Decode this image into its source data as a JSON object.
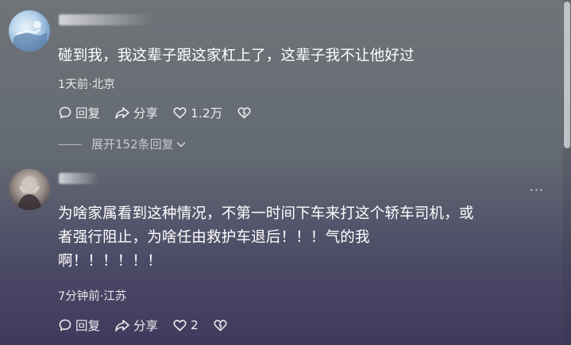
{
  "comments": [
    {
      "text": "碰到我，我这辈子跟这家杠上了，这辈子我不让他好过",
      "meta": "1天前·北京",
      "reply_label": "回复",
      "share_label": "分享",
      "like_count": "1.2万",
      "expand_label": "展开152条回复"
    },
    {
      "text_line1": "为啥家属看到这种情况，不第一时间下车来打这个轿车司机，或",
      "text_line2": "者强行阻止，为啥任由救护车退后！！！气的我",
      "text_line3": "啊！！！！！！",
      "meta": "7分钟前·江苏",
      "reply_label": "回复",
      "share_label": "分享",
      "like_count": "2",
      "more_label": "···"
    }
  ],
  "icons": [
    "comment-bubble-icon",
    "share-arrow-icon",
    "heart-icon",
    "dislike-heart-icon",
    "chevron-down-icon"
  ]
}
